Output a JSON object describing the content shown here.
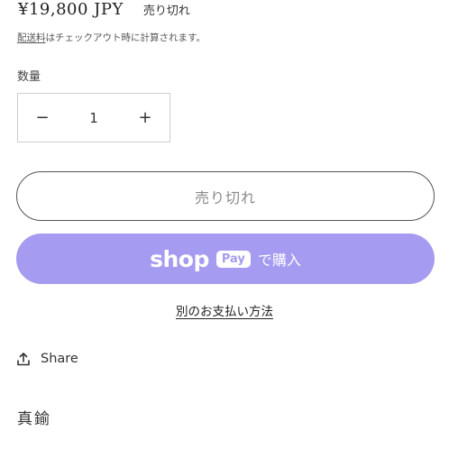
{
  "product": {
    "price": "¥19,800 JPY",
    "sold_badge": "売り切れ",
    "shipping_link": "配送料",
    "shipping_rest": "はチェックアウト時に計算されます。"
  },
  "quantity": {
    "label": "数量",
    "minus": "−",
    "value": "1",
    "plus": "+"
  },
  "buttons": {
    "sold_out": "売り切れ",
    "shop_word": "shop",
    "pay_pill": "Pay",
    "buy_text": "で購入",
    "more_payment": "別のお支払い方法",
    "shoppay_color": "#a59bf0"
  },
  "share": {
    "label": "Share",
    "icon": "share-icon"
  },
  "section": {
    "title": "真鍮"
  }
}
